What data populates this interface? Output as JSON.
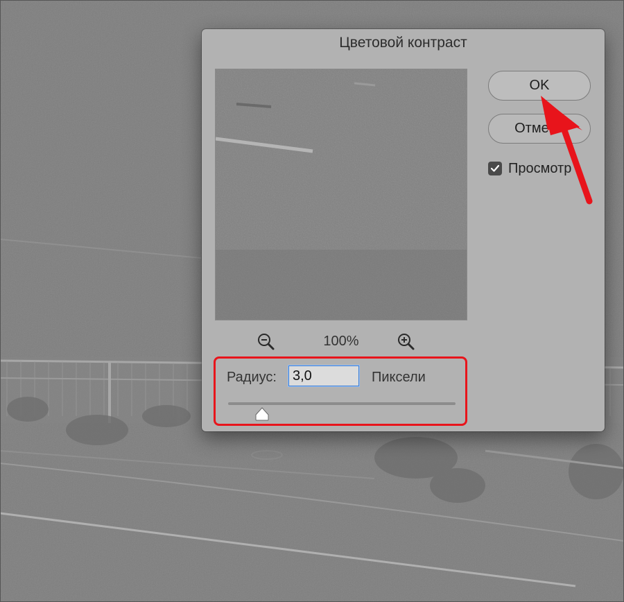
{
  "dialog": {
    "title": "Цветовой контраст",
    "zoom": {
      "value": "100%",
      "zoom_out_icon": "zoom-out-icon",
      "zoom_in_icon": "zoom-in-icon"
    },
    "radius": {
      "label": "Радиус:",
      "value": "3,0",
      "unit": "Пиксели",
      "slider_fraction": 0.15
    },
    "buttons": {
      "ok": "OK",
      "cancel": "Отмена"
    },
    "preview_checkbox": {
      "label": "Просмотр",
      "checked": true
    }
  },
  "annotations": {
    "highlight_color": "#e8141b",
    "arrow_color": "#e8141b"
  },
  "colors": {
    "dialog_bg": "#b2b2b2",
    "canvas_bg": "#7d7d7d",
    "input_focus": "#3d7fd6"
  }
}
